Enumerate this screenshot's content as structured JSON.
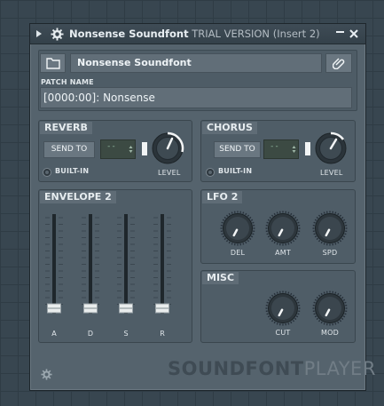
{
  "window": {
    "title_name": "Nonsense Soundfont",
    "title_trial": "TRIAL VERSION",
    "title_insert": "(Insert 2)"
  },
  "header": {
    "preset_name": "Nonsense Soundfont",
    "patch_name_label": "PATCH NAME",
    "patch_value": "[0000:00]: Nonsense"
  },
  "reverb": {
    "title": "REVERB",
    "send_to_label": "SEND TO",
    "send_value": "--",
    "builtin_label": "BUILT-IN",
    "level_label": "LEVEL"
  },
  "chorus": {
    "title": "CHORUS",
    "send_to_label": "SEND TO",
    "send_value": "--",
    "builtin_label": "BUILT-IN",
    "level_label": "LEVEL"
  },
  "envelope": {
    "title": "ENVELOPE 2",
    "faders": [
      {
        "label": "A"
      },
      {
        "label": "D"
      },
      {
        "label": "S"
      },
      {
        "label": "R"
      }
    ]
  },
  "lfo": {
    "title": "LFO 2",
    "knobs": [
      {
        "label": "DEL"
      },
      {
        "label": "AMT"
      },
      {
        "label": "SPD"
      }
    ]
  },
  "misc": {
    "title": "MISC",
    "knobs": [
      {
        "label": "CUT"
      },
      {
        "label": "MOD"
      }
    ]
  },
  "brand": {
    "part1": "SOUNDFONT",
    "part2": "PLAYER"
  },
  "colors": {
    "window_bg": "#55636d",
    "knob_arc": "#f2f4f5",
    "lcd_text": "#8fb69d"
  }
}
